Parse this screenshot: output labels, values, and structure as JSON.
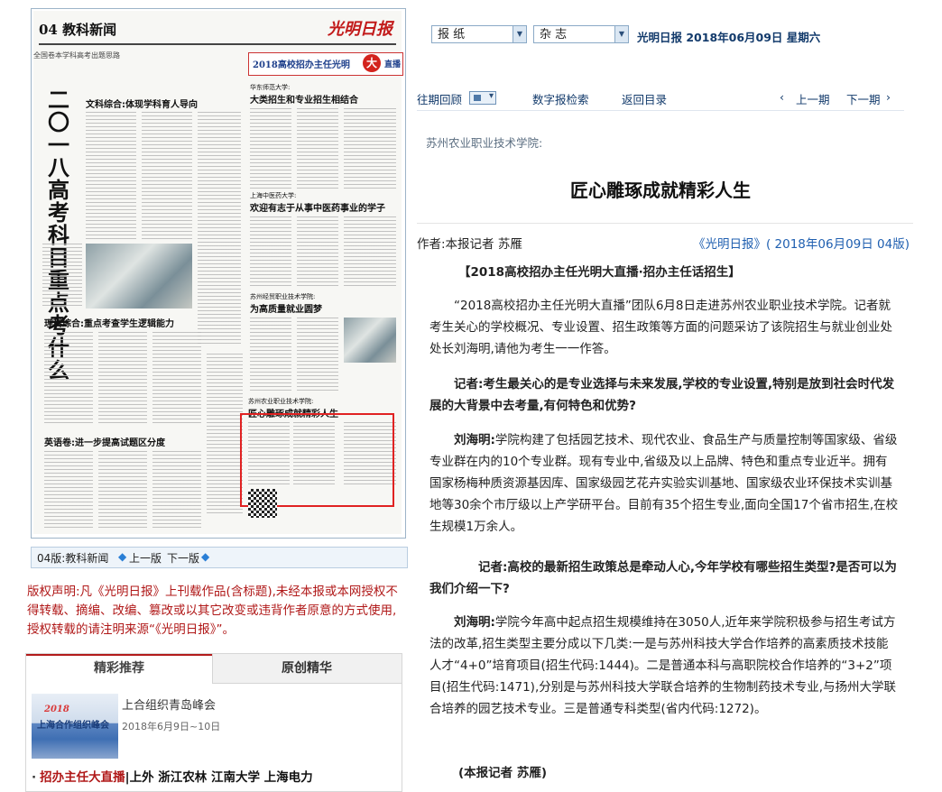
{
  "paper": {
    "page_label": "04 教科新闻",
    "flag": "光明日报",
    "vertical_headline": "二〇一八高考科目重点考什么",
    "sub_line": "全国卷本学科高考出题思路",
    "headline_1": "文科综合:体现学科育人导向",
    "headline_2": "理科综合:重点考查学生逻辑能力",
    "headline_3": "英语卷:进一步提高试题区分度",
    "live_title": "2018高校招办主任光明",
    "live_mark": "大",
    "live_tail": "直播",
    "story_1_school": "华东师范大学:",
    "story_1_title": "大类招生和专业招生相结合",
    "story_2_school": "上海中医药大学:",
    "story_2_title": "欢迎有志于从事中医药事业的学子",
    "story_3_school": "苏州经贸职业技术学院:",
    "story_3_title": "为高质量就业圆梦",
    "story_4_school": "苏州农业职业技术学院:",
    "story_4_title": "匠心雕琢成就精彩人生"
  },
  "page_nav": {
    "label": "04版:教科新闻",
    "prev": "上一版",
    "next": "下一版"
  },
  "copyright": "版权声明:凡《光明日报》上刊载作品(含标题),未经本报或本网授权不得转载、摘编、改编、篡改或以其它改变或违背作者原意的方式使用,授权转载的请注明来源“《光明日报》”。",
  "recommend": {
    "tab_active": "精彩推荐",
    "tab_other": "原创精华",
    "thumb_line1": "2018",
    "thumb_line2": "上海合作组织峰会",
    "item_title": "上合组织青岛峰会",
    "item_date": "2018年6月9日~10日",
    "link_prefix": "招办主任大直播",
    "link_rest": "上外 浙江农林 江南大学 上海电力"
  },
  "toolbar": {
    "select_1": "报  纸",
    "select_2": "杂  志",
    "pub_info": "光明日报  2018年06月09日  星期六",
    "past_review": "往期回顾",
    "search": "数字报检索",
    "back_to_index": "返回目录",
    "prev_issue": "上一期",
    "next_issue": "下一期"
  },
  "article": {
    "subtitle": "苏州农业职业技术学院:",
    "title": "匠心雕琢成就精彩人生",
    "author": "作者:本报记者  苏雁",
    "source": "《光明日报》( 2018年06月09日  04版)",
    "p1": "【2018高校招办主任光明大直播·招办主任话招生】",
    "p2": "“2018高校招办主任光明大直播”团队6月8日走进苏州农业职业技术学院。记者就考生关心的学校概况、专业设置、招生政策等方面的问题采访了该院招生与就业创业处处长刘海明,请他为考生一一作答。",
    "p3": "记者:考生最关心的是专业选择与未来发展,学校的专业设置,特别是放到社会时代发展的大背景中去考量,有何特色和优势?",
    "p4_speaker": "刘海明:",
    "p4": "学院构建了包括园艺技术、现代农业、食品生产与质量控制等国家级、省级专业群在内的10个专业群。现有专业中,省级及以上品牌、特色和重点专业近半。拥有国家杨梅种质资源基因库、国家级园艺花卉实验实训基地、国家级农业环保技术实训基地等30余个市厅级以上产学研平台。目前有35个招生专业,面向全国17个省市招生,在校生规模1万余人。",
    "p5": "记者:高校的最新招生政策总是牵动人心,今年学校有哪些招生类型?是否可以为我们介绍一下?",
    "p6_speaker": "刘海明:",
    "p6": "学院今年高中起点招生规模维持在3050人,近年来学院积极参与招生考试方法的改革,招生类型主要分成以下几类:一是与苏州科技大学合作培养的高素质技术技能人才“4+0”培育项目(招生代码:1444)。二是普通本科与高职院校合作培养的“3+2”项目(招生代码:1471),分别是与苏州科技大学联合培养的生物制药技术专业,与扬州大学联合培养的园艺技术专业。三是普通专科类型(省内代码:1272)。",
    "p7": "(本报记者  苏雁)"
  }
}
